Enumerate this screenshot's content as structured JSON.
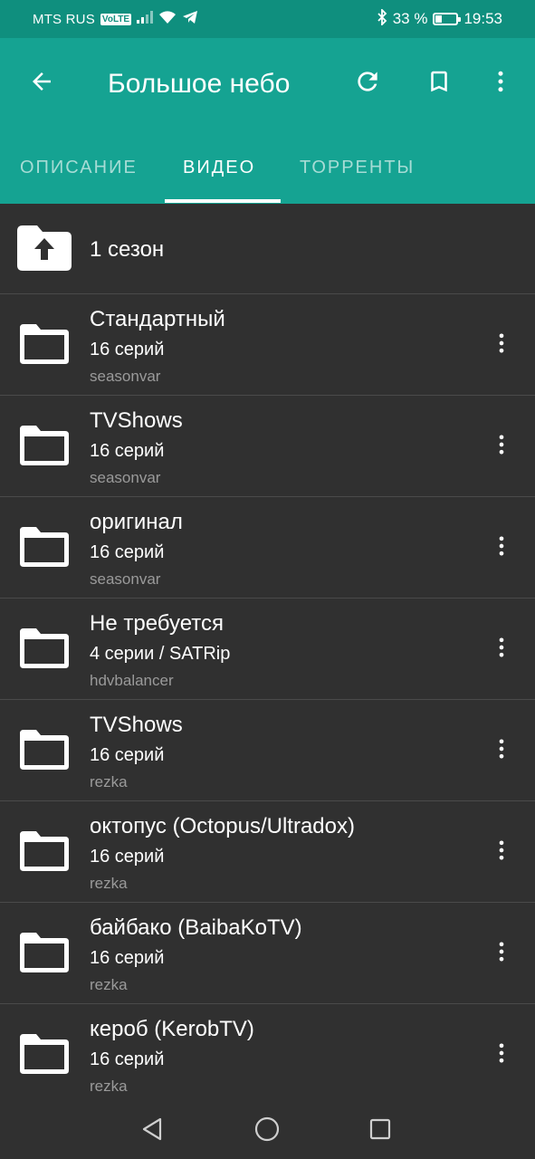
{
  "status_bar": {
    "carrier": "MTS RUS",
    "volte": "VoLTE",
    "battery": "33 %",
    "battery_level": 0.33,
    "time": "19:53"
  },
  "app_bar": {
    "title": "Большое небо",
    "background": "#15a392"
  },
  "tabs": [
    {
      "label": "ОПИСАНИЕ",
      "active": false
    },
    {
      "label": "ВИДЕО",
      "active": true
    },
    {
      "label": "ТОРРЕНТЫ",
      "active": false
    }
  ],
  "list": {
    "up_item": {
      "label": "1 сезон"
    },
    "items": [
      {
        "name": "Стандартный",
        "count": "16 серий",
        "source": "seasonvar"
      },
      {
        "name": "TVShows",
        "count": "16 серий",
        "source": "seasonvar"
      },
      {
        "name": "оригинал",
        "count": "16 серий",
        "source": "seasonvar"
      },
      {
        "name": "Не требуется",
        "count": "4 серии / SATRip",
        "source": "hdvbalancer"
      },
      {
        "name": "TVShows",
        "count": "16 серий",
        "source": "rezka"
      },
      {
        "name": "октопус (Octopus/Ultradox)",
        "count": "16 серий",
        "source": "rezka"
      },
      {
        "name": "байбако (BaibaKoTV)",
        "count": "16 серий",
        "source": "rezka"
      },
      {
        "name": "кероб (KerobTV)",
        "count": "16 серий",
        "source": "rezka"
      }
    ]
  }
}
